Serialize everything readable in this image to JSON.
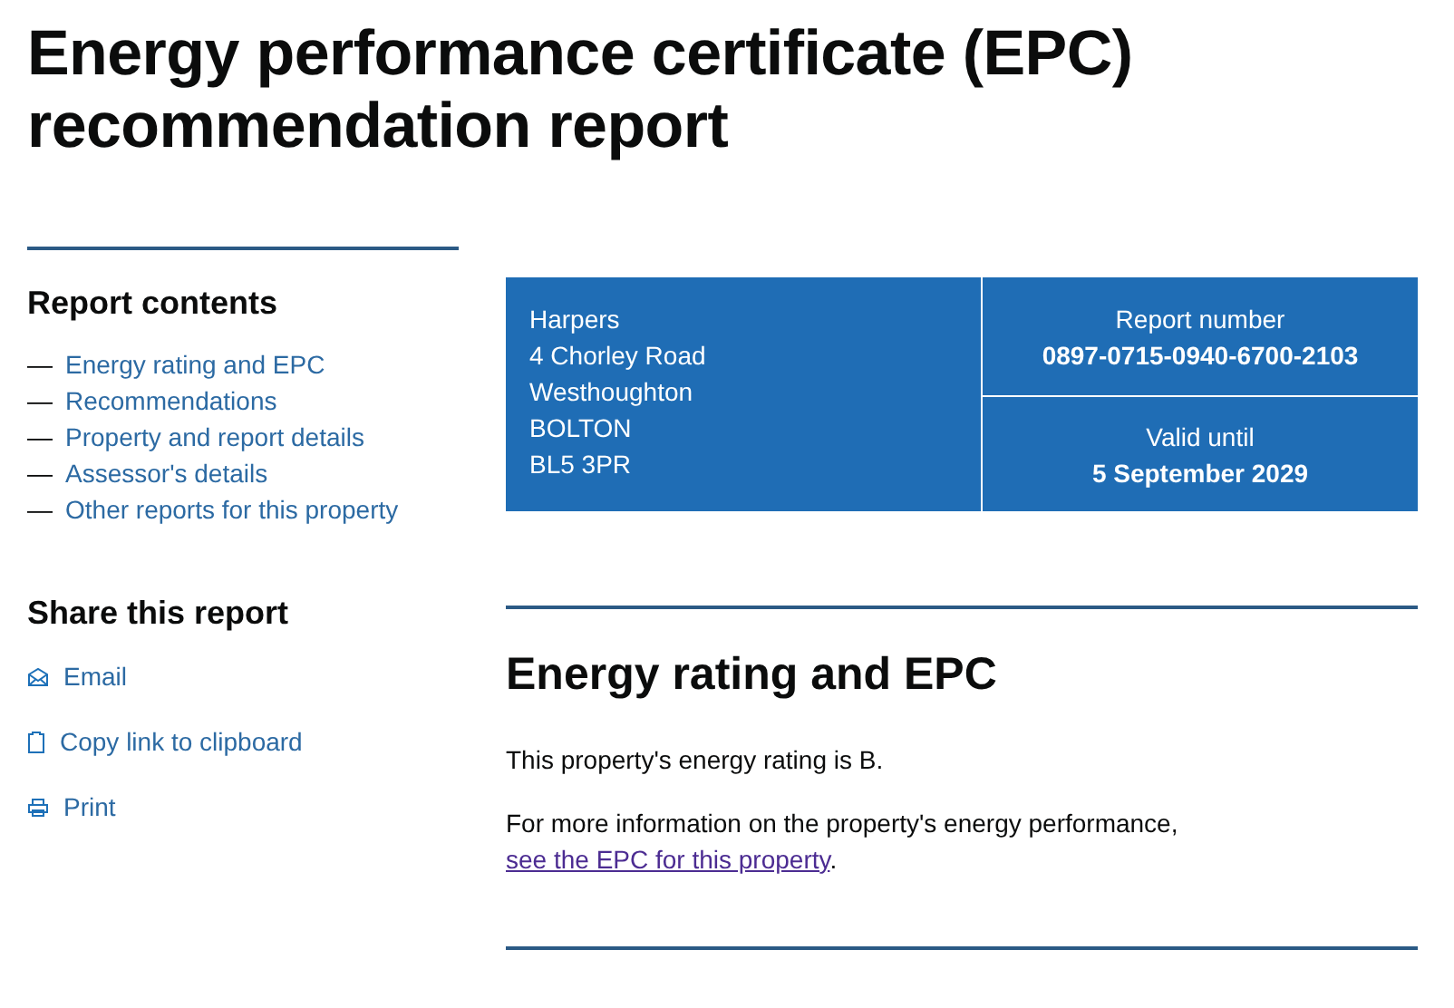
{
  "title": "Energy performance certificate (EPC) recommendation report",
  "contents": {
    "heading": "Report contents",
    "items": [
      {
        "dash": "—",
        "label": "Energy rating and EPC"
      },
      {
        "dash": "—",
        "label": "Recommendations"
      },
      {
        "dash": "—",
        "label": "Property and report details"
      },
      {
        "dash": "—",
        "label": "Assessor's details"
      },
      {
        "dash": "—",
        "label": "Other reports for this property"
      }
    ]
  },
  "share": {
    "heading": "Share this report",
    "items": [
      {
        "kind": "email",
        "label": "Email"
      },
      {
        "kind": "copy",
        "label": "Copy link to clipboard"
      },
      {
        "kind": "print",
        "label": "Print"
      }
    ]
  },
  "summary": {
    "address": [
      "Harpers",
      "4 Chorley Road",
      "Westhoughton",
      "BOLTON",
      "BL5 3PR"
    ],
    "report_number": {
      "label": "Report number",
      "value": "0897-0715-0940-6700-2103"
    },
    "valid_until": {
      "label": "Valid until",
      "value": "5 September 2029"
    }
  },
  "section": {
    "heading": "Energy rating and EPC",
    "text": "This property's energy rating is B.",
    "more_text": "For more information on the property's energy performance, ",
    "link": "see the EPC for this property",
    "end": "."
  }
}
